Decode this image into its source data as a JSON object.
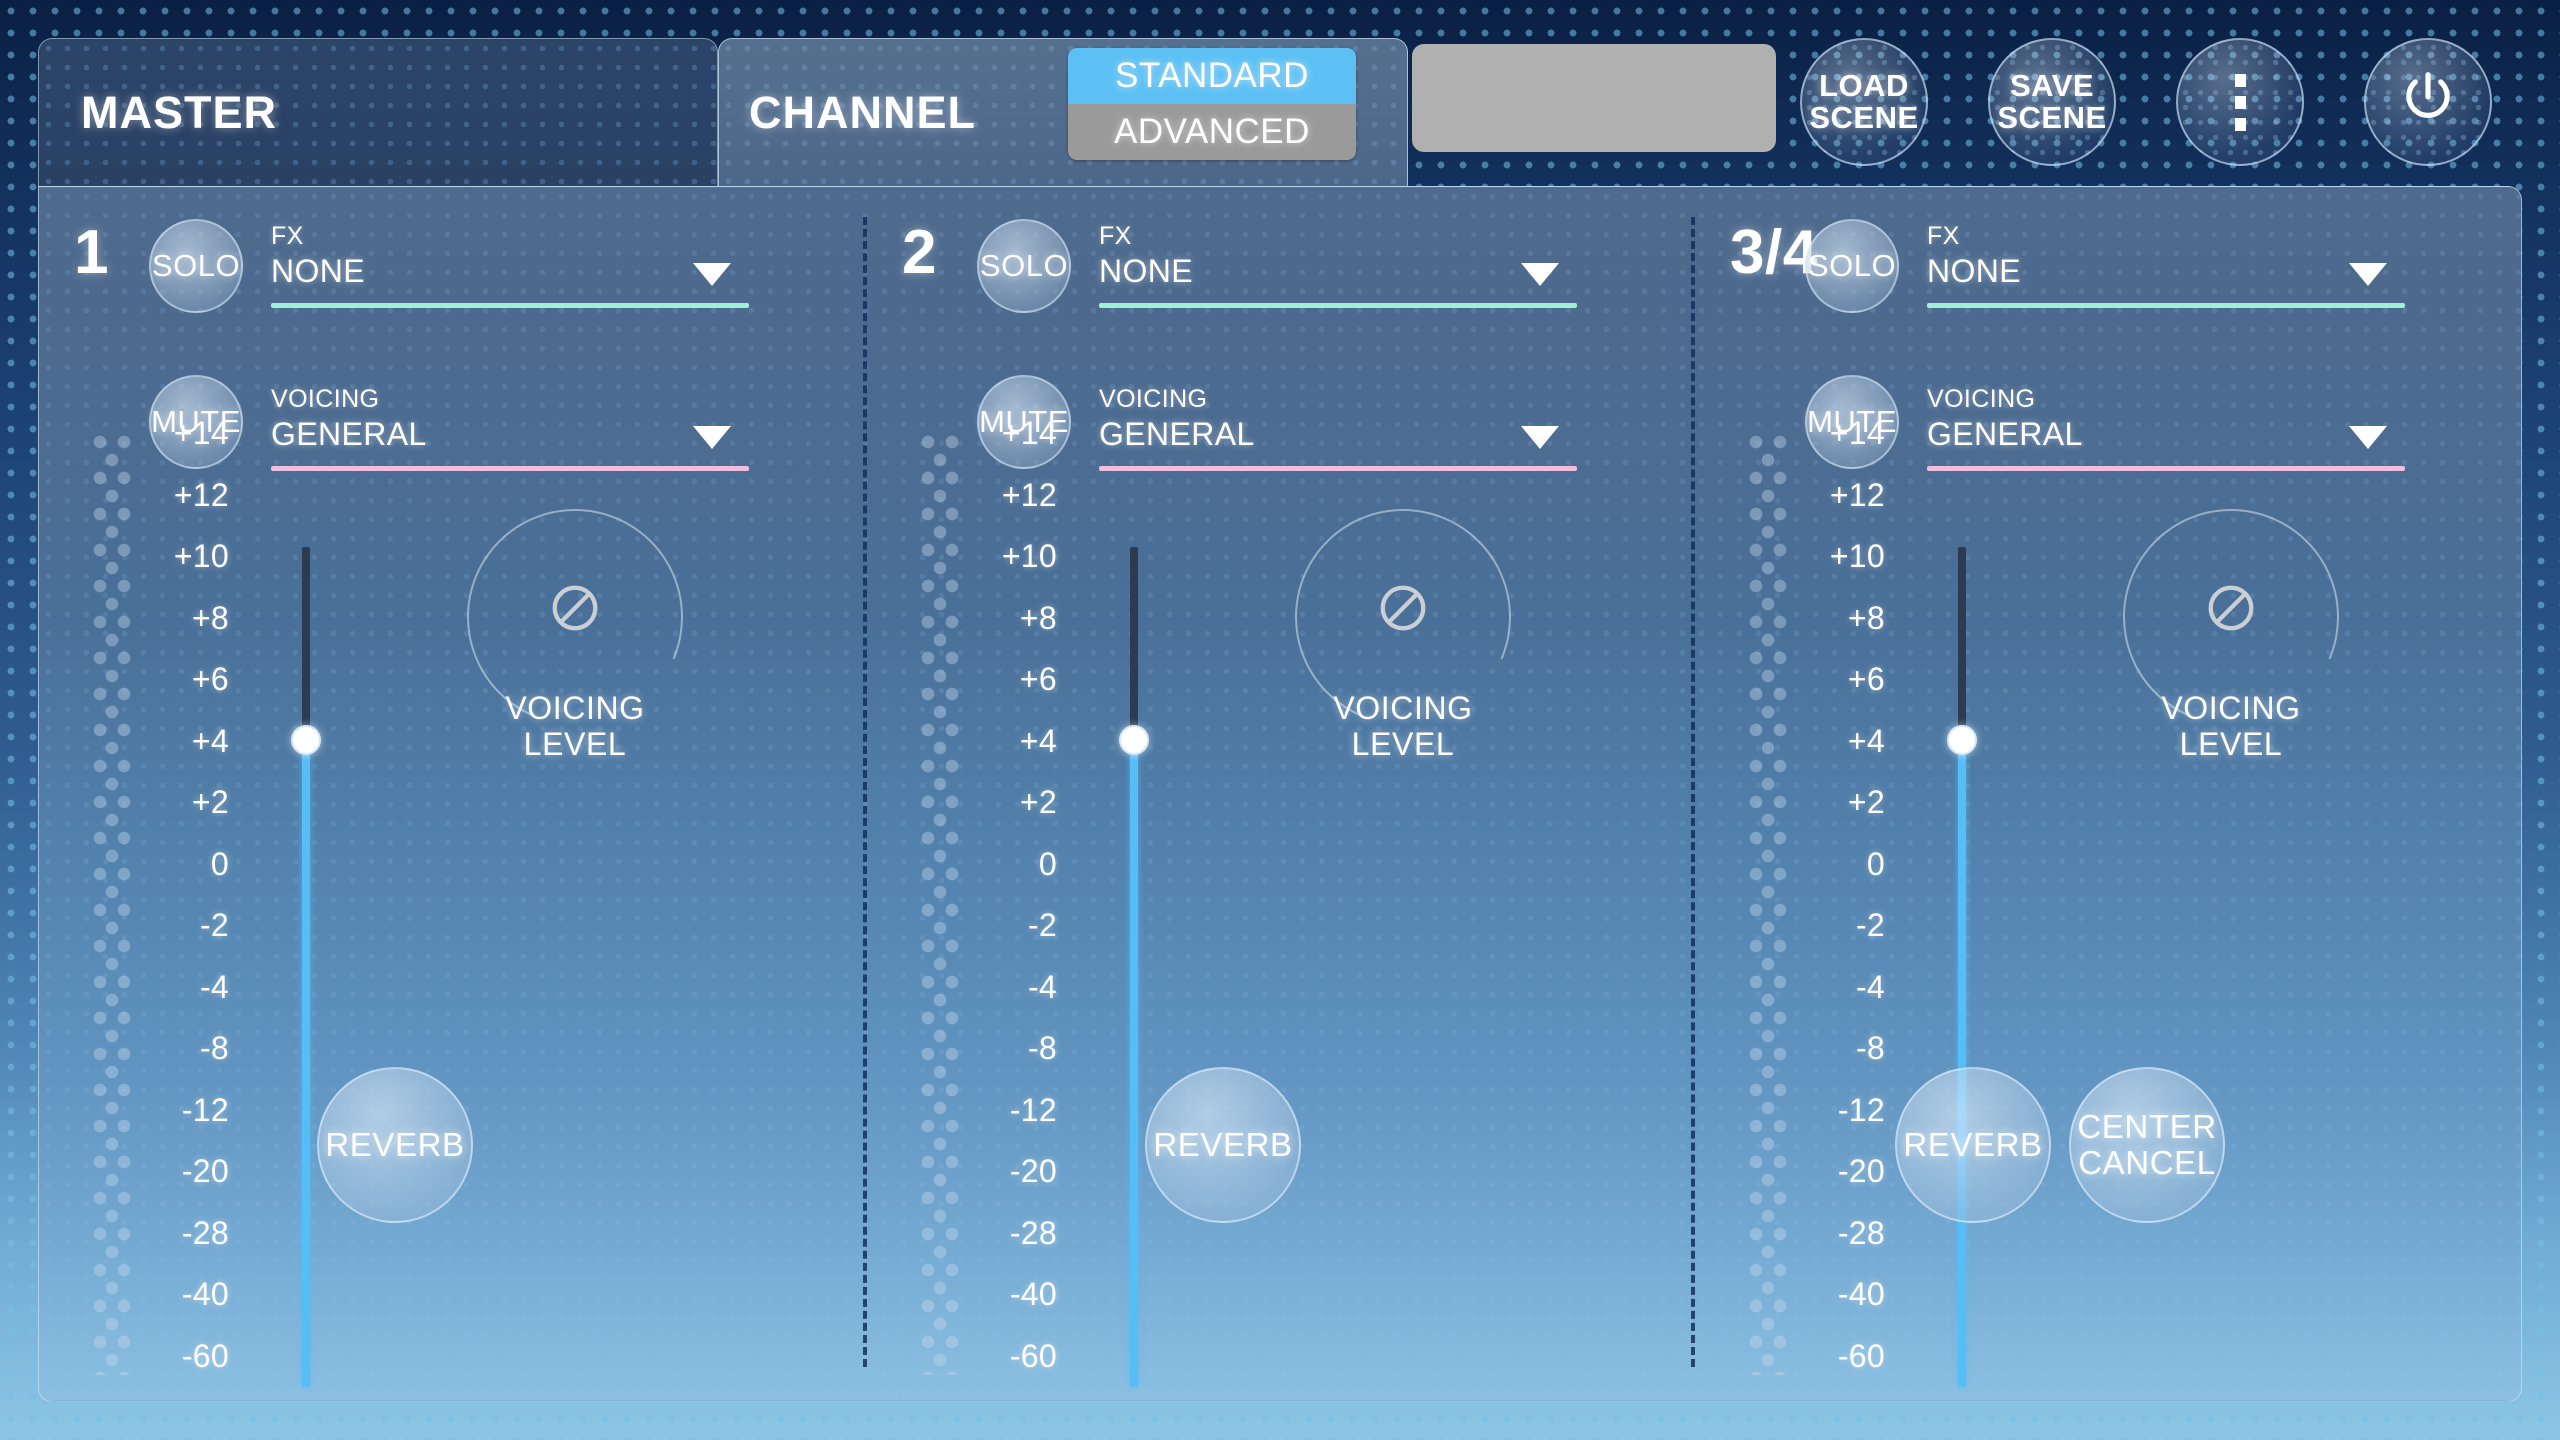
{
  "header": {
    "tabs": [
      {
        "label": "MASTER",
        "active": false,
        "name": "tab-master"
      },
      {
        "label": "CHANNEL",
        "active": true,
        "name": "tab-channel"
      }
    ],
    "mode_switch": {
      "standard_label": "STANDARD",
      "advanced_label": "ADVANCED",
      "selected": "STANDARD",
      "active_color": "#5cc0f4",
      "inactive_color": "#9a9a9a"
    },
    "display_panel": {
      "value": "",
      "color": "#b0b0b0"
    },
    "buttons": [
      {
        "name": "load-scene-button",
        "line1": "LOAD",
        "line2": "SCENE"
      },
      {
        "name": "save-scene-button",
        "line1": "SAVE",
        "line2": "SCENE"
      },
      {
        "name": "overflow-menu-button",
        "icon": "dots-vertical-icon"
      },
      {
        "name": "power-button",
        "icon": "power-icon"
      }
    ]
  },
  "colors": {
    "fx_underline": "#9ff0d4",
    "voicing_underline": "#f0bedf",
    "fader_fill": "#57bdf7",
    "fader_track": "#2c3a52",
    "accent": "#5cc0f4"
  },
  "scale_ticks": [
    "+14",
    "+12",
    "+10",
    "+8",
    "+6",
    "+4",
    "+2",
    "0",
    "-2",
    "-4",
    "-8",
    "-12",
    "-20",
    "-28",
    "-40",
    "-60"
  ],
  "channels": [
    {
      "number": "1",
      "solo_label": "SOLO",
      "mute_label": "MUTE",
      "fx": {
        "label": "FX",
        "value": "NONE"
      },
      "voicing": {
        "label": "VOICING",
        "value": "GENERAL"
      },
      "knob": {
        "label_line1": "VOICING",
        "label_line2": "LEVEL",
        "icon": "prohibited-icon"
      },
      "fader": {
        "value_db": "+4",
        "thumb_percent": 78
      },
      "buttons": [
        {
          "name": "reverb-button",
          "line1": "REVERB",
          "line2": ""
        }
      ]
    },
    {
      "number": "2",
      "solo_label": "SOLO",
      "mute_label": "MUTE",
      "fx": {
        "label": "FX",
        "value": "NONE"
      },
      "voicing": {
        "label": "VOICING",
        "value": "GENERAL"
      },
      "knob": {
        "label_line1": "VOICING",
        "label_line2": "LEVEL",
        "icon": "prohibited-icon"
      },
      "fader": {
        "value_db": "+4",
        "thumb_percent": 78
      },
      "buttons": [
        {
          "name": "reverb-button",
          "line1": "REVERB",
          "line2": ""
        }
      ]
    },
    {
      "number": "3/4",
      "solo_label": "SOLO",
      "mute_label": "MUTE",
      "fx": {
        "label": "FX",
        "value": "NONE"
      },
      "voicing": {
        "label": "VOICING",
        "value": "GENERAL"
      },
      "knob": {
        "label_line1": "VOICING",
        "label_line2": "LEVEL",
        "icon": "prohibited-icon"
      },
      "fader": {
        "value_db": "+4",
        "thumb_percent": 78
      },
      "buttons": [
        {
          "name": "reverb-button",
          "line1": "REVERB",
          "line2": ""
        },
        {
          "name": "center-cancel-button",
          "line1": "CENTER",
          "line2": "CANCEL"
        }
      ]
    }
  ]
}
